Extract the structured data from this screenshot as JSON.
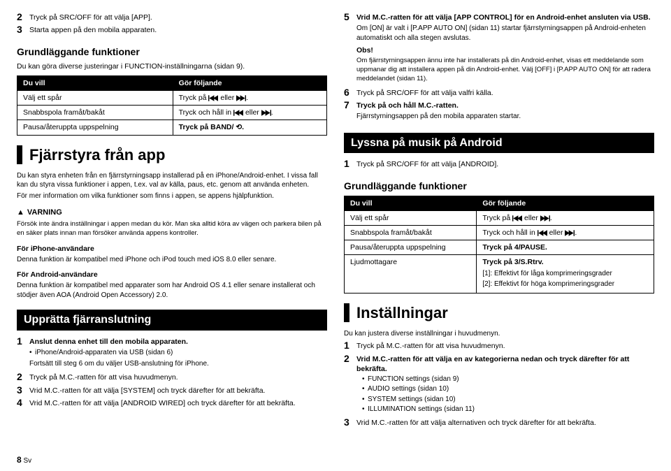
{
  "left": {
    "steps_a": [
      {
        "n": "2",
        "bold": "Tryck på SRC/OFF för att välja [APP]."
      },
      {
        "n": "3",
        "bold": "Starta appen på den mobila apparaten."
      }
    ],
    "grund_title": "Grundläggande funktioner",
    "grund_lead": "Du kan göra diverse justeringar i FUNCTION-inställningarna (sidan 9).",
    "th1": "Du vill",
    "th2": "Gör följande",
    "tbl_a": [
      {
        "l": "Välj ett spår",
        "r1": "Tryck på ",
        "r2": " eller ",
        "r3": "."
      },
      {
        "l": "Snabbspola framåt/bakåt",
        "r1": "Tryck och håll in ",
        "r2": " eller ",
        "r3": "."
      },
      {
        "l": "Pausa/återuppta uppspelning",
        "r": "Tryck på BAND/ ⟲."
      }
    ],
    "h_remote": "Fjärrstyra från app",
    "remote_p1": "Du kan styra enheten från en fjärrstyrningsapp installerad på en iPhone/Android-enhet. I vissa fall kan du styra vissa funktioner i appen, t.ex. val av källa, paus, etc. genom att använda enheten.",
    "remote_p2": "För mer information om vilka funktioner som finns i appen, se appens hjälpfunktion.",
    "warn_label": "VARNING",
    "warn_p": "Försök inte ändra inställningar i appen medan du kör. Man ska alltid köra av vägen och parkera bilen på en säker plats innan man försöker använda appens kontroller.",
    "iphone_h": "För iPhone-användare",
    "iphone_p": "Denna funktion är kompatibel med iPhone och iPod touch med iOS 8.0 eller senare.",
    "android_h": "För Android-användare",
    "android_p": "Denna funktion är kompatibel med apparater som har Android OS 4.1 eller senare installerat och stödjer även AOA (Android Open Accessory) 2.0.",
    "upp_title": "Upprätta fjärranslutning",
    "steps_b": [
      {
        "n": "1",
        "bold": "Anslut denna enhet till den mobila apparaten.",
        "sub1": "iPhone/Android-apparaten via USB (sidan 6)",
        "sub2": "Fortsätt till steg 6 om du väljer USB-anslutning för iPhone."
      },
      {
        "n": "2",
        "bold": "Tryck på M.C.-ratten för att visa huvudmenyn."
      },
      {
        "n": "3",
        "bold": "Vrid M.C.-ratten för att välja [SYSTEM] och tryck därefter för att bekräfta."
      },
      {
        "n": "4",
        "bold": "Vrid M.C.-ratten för att välja [ANDROID WIRED] och tryck därefter för att bekräfta."
      }
    ]
  },
  "right": {
    "steps_c": [
      {
        "n": "5",
        "bold": "Vrid M.C.-ratten för att välja [APP CONTROL] för en Android-enhet ansluten via USB.",
        "p1": "Om [ON] är valt i [P.APP AUTO ON] (sidan 11) startar fjärrstyrningsappen på Android-enheten automatiskt och alla stegen avslutas.",
        "obs_label": "Obs!",
        "obs_p": "Om fjärrstyrningsappen ännu inte har installerats på din Android-enhet, visas ett meddelande som uppmanar dig att installera appen på din Android-enhet. Välj [OFF] i [P.APP AUTO ON] för att radera meddelandet (sidan 11)."
      },
      {
        "n": "6",
        "bold": "Tryck på SRC/OFF för att välja valfri källa."
      },
      {
        "n": "7",
        "bold": "Tryck på och håll M.C.-ratten.",
        "p1": "Fjärrstyrningsappen på den mobila apparaten startar."
      }
    ],
    "lyssna_title": "Lyssna på musik på Android",
    "lyssna_step": {
      "n": "1",
      "bold": "Tryck på SRC/OFF för att välja [ANDROID]."
    },
    "grund_title": "Grundläggande funktioner",
    "th1": "Du vill",
    "th2": "Gör följande",
    "tbl_b": [
      {
        "l": "Välj ett spår",
        "r1": "Tryck på ",
        "r2": " eller ",
        "r3": "."
      },
      {
        "l": "Snabbspola framåt/bakåt",
        "r1": "Tryck och håll in ",
        "r2": " eller ",
        "r3": "."
      },
      {
        "l": "Pausa/återuppta uppspelning",
        "r": "Tryck på 4/PAUSE."
      },
      {
        "l": "Ljudmottagare",
        "r": "Tryck på 3/S.Rtrv.",
        "r_extra1": "[1]: Effektivt för låga komprimeringsgrader",
        "r_extra2": "[2]: Effektivt för höga komprimeringsgrader"
      }
    ],
    "inst_title": "Inställningar",
    "inst_lead": "Du kan justera diverse inställningar i huvudmenyn.",
    "steps_d": [
      {
        "n": "1",
        "bold": "Tryck på M.C.-ratten för att visa huvudmenyn."
      },
      {
        "n": "2",
        "bold": "Vrid M.C.-ratten för att välja en av kategorierna nedan och tryck därefter för att bekräfta.",
        "bul": [
          "FUNCTION settings (sidan 9)",
          "AUDIO settings (sidan 10)",
          "SYSTEM settings (sidan 10)",
          "ILLUMINATION settings (sidan 11)"
        ]
      },
      {
        "n": "3",
        "bold": "Vrid M.C.-ratten för att välja alternativen och tryck därefter för att bekräfta."
      }
    ]
  },
  "page_num": "8",
  "page_lang": "Sv"
}
